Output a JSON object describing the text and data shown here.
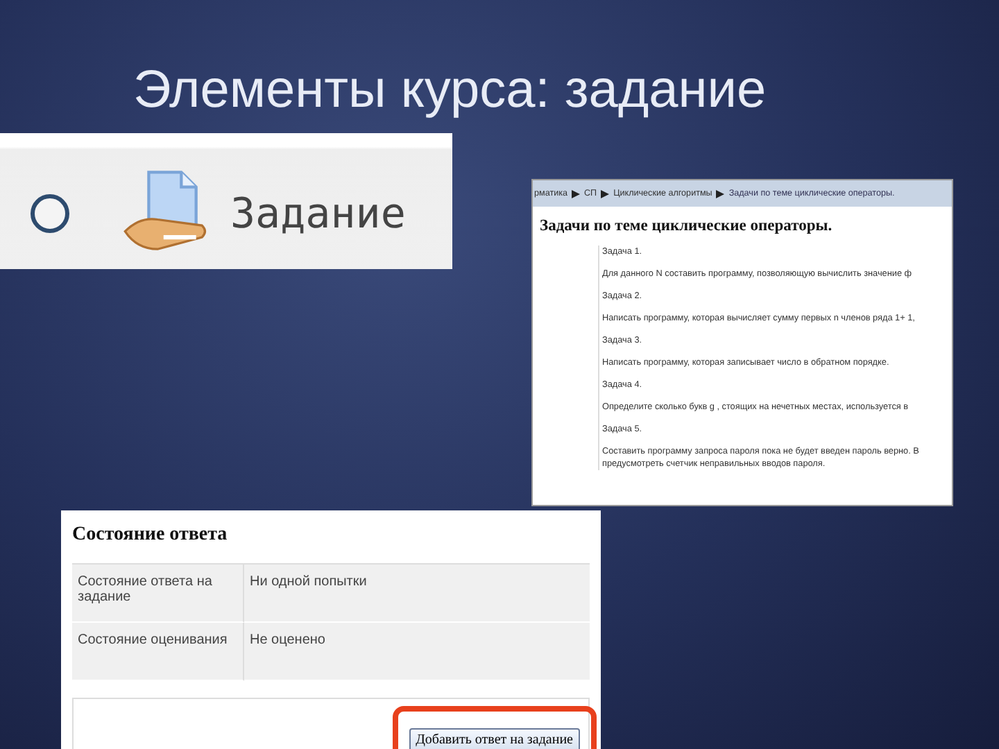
{
  "slide": {
    "title": "Элементы курса: задание"
  },
  "activity": {
    "label": "Задание",
    "checked": false
  },
  "assignment_page": {
    "breadcrumb": [
      {
        "text": "рматика"
      },
      {
        "text": "СП"
      },
      {
        "text": "Циклические алгоритмы"
      },
      {
        "text": "Задачи по теме циклические операторы."
      }
    ],
    "heading": "Задачи по теме циклические операторы.",
    "paragraphs": [
      "Задача 1.",
      "Для данного N составить программу, позволяющую вычислить значение ф",
      "Задача 2.",
      "Написать программу, которая вычисляет сумму первых n членов ряда 1+ 1,",
      "Задача 3.",
      "Написать программу, которая записывает число в обратном порядке.",
      "Задача 4.",
      "Определите сколько букв g , стоящих на нечетных местах, используется в",
      "Задача 5.",
      "Составить программу запроса пароля пока не будет введен пароль верно. В предусмотреть счетчик неправильных вводов пароля."
    ]
  },
  "submission_status": {
    "heading": "Состояние ответа",
    "rows": [
      {
        "label": "Состояние ответа на задание",
        "value": "Ни одной попытки"
      },
      {
        "label": "Состояние оценивания",
        "value": "Не оценено"
      }
    ],
    "button": "Добавить ответ на задание",
    "button_highlighted": true
  }
}
